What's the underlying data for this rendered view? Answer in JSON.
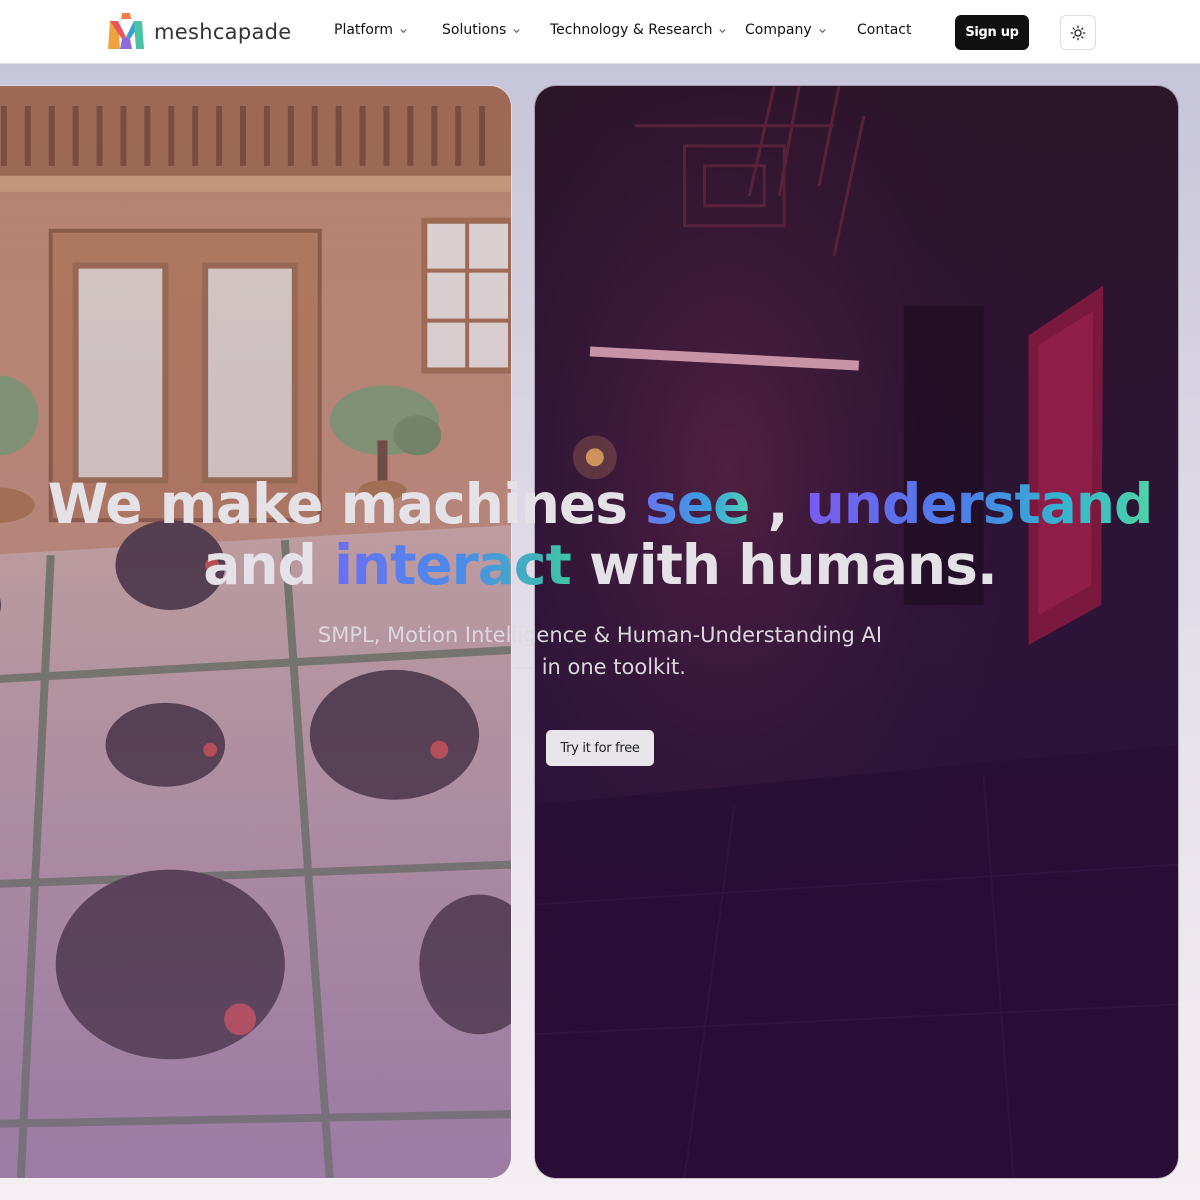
{
  "brand": {
    "name": "meshcapade",
    "logo_icon": "meshcapade-m-logo"
  },
  "nav": {
    "items": [
      {
        "label": "Platform",
        "has_dropdown": true
      },
      {
        "label": "Solutions",
        "has_dropdown": true
      },
      {
        "label": "Technology & Research",
        "has_dropdown": true
      },
      {
        "label": "Company",
        "has_dropdown": true
      },
      {
        "label": "Contact",
        "has_dropdown": false
      }
    ],
    "signup_label": "Sign up",
    "theme_toggle_icon": "sun-icon"
  },
  "hero": {
    "headline": {
      "part1": "We make machines ",
      "word_see": "see",
      "sep": " , ",
      "word_understand": "understand",
      "part2": "and ",
      "word_interact": "interact",
      "part3": " with humans."
    },
    "subtitle_line1": "SMPL, Motion Intelligence & Human-Understanding AI",
    "subtitle_line2": "— in one toolkit.",
    "cta_label": "Try it for free"
  },
  "colors": {
    "header_bg": "#ffffff",
    "signup_bg": "#111111",
    "hero_gradient_start": "#6a74f0",
    "hero_gradient_end": "#4fd1b4"
  }
}
